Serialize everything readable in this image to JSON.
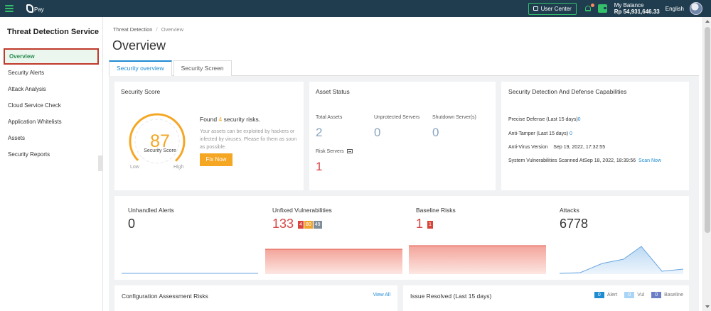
{
  "topbar": {
    "logo_text": "Pay",
    "user_center": "User Center",
    "balance_label": "My Balance",
    "balance_value": "Rp 54,931,646.33",
    "language": "English",
    "colors": {
      "bar": "#1f3d4f",
      "accent": "#34c06b"
    }
  },
  "sidebar": {
    "title": "Threat Detection Service",
    "items": [
      {
        "label": "Overview",
        "active": true
      },
      {
        "label": "Security Alerts"
      },
      {
        "label": "Attack Analysis"
      },
      {
        "label": "Cloud Service Check"
      },
      {
        "label": "Application Whitelists"
      },
      {
        "label": "Assets"
      },
      {
        "label": "Security Reports"
      }
    ]
  },
  "breadcrumb": {
    "parent": "Threat Detection",
    "separator": "/",
    "current": "Overview"
  },
  "page_title": "Overview",
  "tabs": [
    {
      "label": "Security overview",
      "active": true
    },
    {
      "label": "Security Screen"
    }
  ],
  "security_score": {
    "title": "Security Score",
    "score": "87",
    "score_fraction": 0.87,
    "score_label": "Security Score",
    "low": "Low",
    "high": "High",
    "found_prefix": "Found",
    "found_count": "4",
    "found_suffix": "security risks.",
    "description": "Your assets can be exploited by hackers or infected by viruses. Please fix them as soon as possible.",
    "fix_button": "Fix Now",
    "color": "#f5a623"
  },
  "asset_status": {
    "title": "Asset Status",
    "total_label": "Total Assets",
    "total_value": "2",
    "unprotected_label": "Unprotected Servers",
    "unprotected_value": "0",
    "shutdown_label": "Shutdown Server(s)",
    "shutdown_value": "0",
    "risk_label": "Risk Servers",
    "risk_value": "1"
  },
  "capabilities": {
    "title": "Security Detection And Defense Capabilities",
    "precise_label": "Precise Defense (Last 15 days)",
    "precise_value": "0",
    "tamper_label": "Anti-Tamper  (Last 15 days)",
    "tamper_value": "0",
    "antivirus_label": "Anti-Virus Version",
    "antivirus_value": "Sep 19, 2022, 17:32:55",
    "vuln_label": "System Vulnerabilities Scanned At",
    "vuln_value": "Sep 18, 2022, 18:39:56",
    "scan_now": "Scan Now"
  },
  "stats": {
    "unhandled_alerts": {
      "label": "Unhandled Alerts",
      "value": "0"
    },
    "unfixed_vulns": {
      "label": "Unfixed Vulnerabilities",
      "value": "133",
      "badges": [
        "4",
        "80",
        "49"
      ]
    },
    "baseline_risks": {
      "label": "Baseline Risks",
      "value": "1",
      "badge": "1"
    },
    "attacks": {
      "label": "Attacks",
      "value": "6778"
    }
  },
  "config_risks": {
    "title": "Configuration Assessment Risks",
    "view_all": "View All"
  },
  "issue_resolved": {
    "title": "Issue Resolved (Last 15 days)",
    "legend": [
      {
        "count": "0",
        "name": "Alert",
        "color": "#1f8bd1"
      },
      {
        "count": "0",
        "name": "Vul",
        "color": "#a9d4f5"
      },
      {
        "count": "0",
        "name": "Baseline",
        "color": "#6b7fc7"
      }
    ]
  }
}
